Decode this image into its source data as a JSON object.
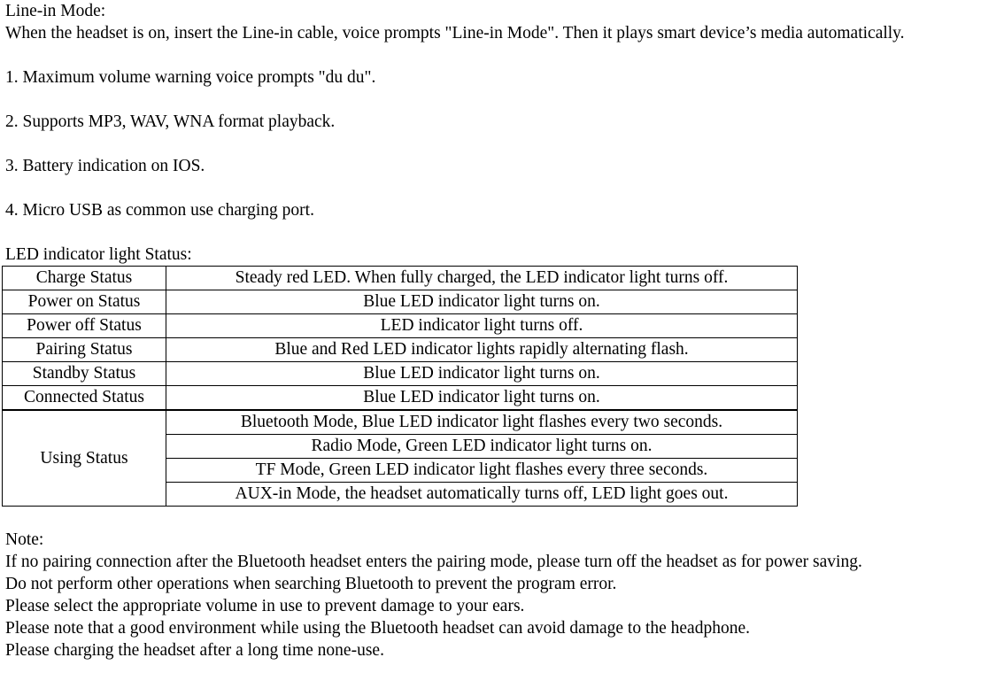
{
  "document": {
    "intro": {
      "heading": "Line-in Mode:",
      "body": "When the headset is on, insert the Line-in cable, voice prompts \"Line-in Mode\". Then it plays smart device’s media automatically."
    },
    "features": [
      "1. Maximum volume warning voice prompts \"du du\".",
      "2. Supports MP3, WAV, WNA format playback.",
      "3. Battery indication on IOS.",
      "4. Micro USB as common use charging port."
    ],
    "table": {
      "caption": "LED indicator light Status:",
      "rows": [
        {
          "label": "Charge Status",
          "value": "Steady red LED. When fully charged, the LED indicator light turns off."
        },
        {
          "label": "Power on Status",
          "value": "Blue LED indicator light turns on."
        },
        {
          "label": "Power off Status",
          "value": "LED indicator light turns off."
        },
        {
          "label": "Pairing Status",
          "value": "Blue and Red LED indicator lights rapidly alternating flash."
        },
        {
          "label": "Standby Status",
          "value": "Blue LED indicator light turns on."
        },
        {
          "label": "Connected Status",
          "value": "Blue LED indicator light turns on."
        }
      ],
      "using_status": {
        "label": "Using Status",
        "values": [
          "Bluetooth Mode, Blue LED indicator light flashes every two seconds.",
          "Radio Mode, Green LED indicator light turns on.",
          "TF Mode, Green LED indicator light flashes every three seconds.",
          "AUX-in Mode, the headset automatically turns off, LED light goes out."
        ]
      }
    },
    "notes": {
      "heading": "Note:",
      "lines": [
        "If no pairing connection after the Bluetooth headset enters the pairing mode, please turn off the headset as for power saving.",
        "Do not perform other operations when searching Bluetooth to prevent the program error.",
        "Please select the appropriate volume in use to prevent damage to your ears.",
        "Please note that a good environment while using the Bluetooth headset can avoid damage to the headphone.",
        "Please charging the headset after a long time none-use."
      ]
    }
  }
}
